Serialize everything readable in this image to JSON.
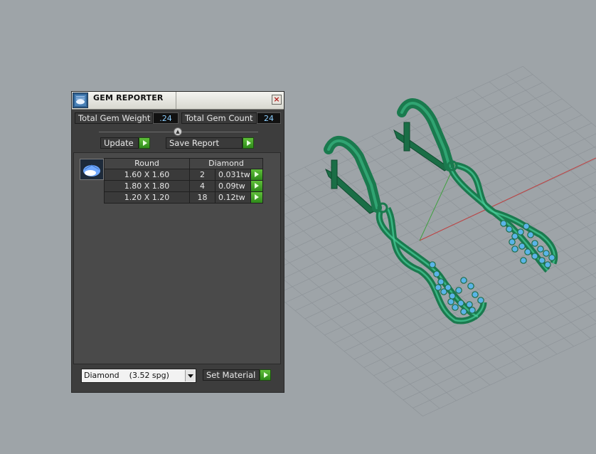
{
  "window": {
    "title": "GEM REPORTER",
    "close_glyph": "×"
  },
  "totals": {
    "weight_label": "Total Gem Weight",
    "weight_value": ".24",
    "count_label": "Total Gem Count",
    "count_value": "24"
  },
  "buttons": {
    "update_label": "Update",
    "save_report_label": "Save Report",
    "set_material_label": "Set Material"
  },
  "table": {
    "columns": [
      "Round",
      "Diamond"
    ],
    "rows": [
      {
        "size": "1.60 X 1.60",
        "count": "2",
        "weight": "0.031tw"
      },
      {
        "size": "1.80 X 1.80",
        "count": "4",
        "weight": "0.09tw"
      },
      {
        "size": "1.20 X 1.20",
        "count": "18",
        "weight": "0.12tw"
      }
    ]
  },
  "material": {
    "selected": "Diamond    (3.52 spg)"
  },
  "icons": {
    "app": "gem-reporter-icon",
    "shape": "round-gem-icon",
    "go": "green-arrow-icon"
  },
  "colors": {
    "viewport_bg": "#9ea4a8",
    "panel_bg": "#3d3d3d",
    "metal": "#1e8a5a",
    "gem": "#5ab4e8",
    "accent_green": "#3fa828"
  }
}
